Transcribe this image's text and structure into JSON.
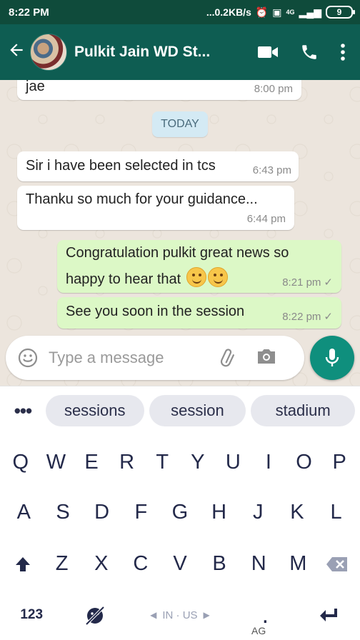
{
  "status_bar": {
    "time": "8:22 PM",
    "net_speed": "...0.2KB/s",
    "network": "4G",
    "battery": "9"
  },
  "header": {
    "contact_name": "Pulkit Jain WD St...",
    "icons": [
      "back-arrow-icon",
      "avatar",
      "video-call-icon",
      "phone-icon",
      "more-vert-icon"
    ]
  },
  "chat": {
    "date_chip": "TODAY",
    "messages": [
      {
        "direction": "in",
        "text": "jae",
        "time": "8:00 pm"
      },
      {
        "direction": "in",
        "text": "Sir i have been selected in tcs",
        "time": "6:43 pm"
      },
      {
        "direction": "in",
        "text": "Thanku so much for your guidance...",
        "time": "6:44 pm"
      },
      {
        "direction": "out",
        "text_line1": "Congratulation pulkit great news so",
        "text_line2": "happy to hear that",
        "emoji": "smiling-face-emoji",
        "time": "8:21 pm",
        "tick": "✓"
      },
      {
        "direction": "out",
        "text": "See you soon in the session",
        "time": "8:22 pm",
        "tick": "✓"
      }
    ]
  },
  "composer": {
    "placeholder": "Type a message"
  },
  "keyboard": {
    "more": "•••",
    "suggestions": [
      "sessions",
      "session",
      "stadium"
    ],
    "row1": [
      "Q",
      "W",
      "E",
      "R",
      "T",
      "Y",
      "U",
      "I",
      "O",
      "P"
    ],
    "row2": [
      "A",
      "S",
      "D",
      "F",
      "G",
      "H",
      "J",
      "K",
      "L"
    ],
    "row3": [
      "Z",
      "X",
      "C",
      "V",
      "B",
      "N",
      "M"
    ],
    "numbers_key": "123",
    "language": "IN · US",
    "period": ".",
    "ag_badge": "AG"
  }
}
